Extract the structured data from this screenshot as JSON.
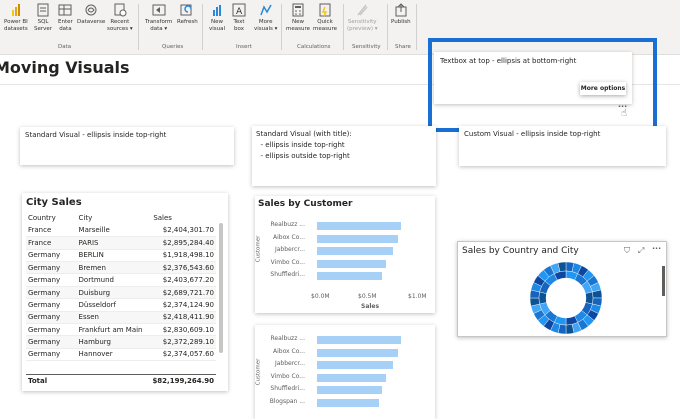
{
  "ribbon": {
    "buttons": [
      {
        "label": "Power BI\ndatasets",
        "icon": "power-bi-dataset-icon"
      },
      {
        "label": "SQL\nServer",
        "icon": "sql-server-icon"
      },
      {
        "label": "Enter\ndata",
        "icon": "table-icon"
      },
      {
        "label": "Dataverse",
        "icon": "dataverse-icon"
      },
      {
        "label": "Recent\nsources ▾",
        "icon": "recent-sources-icon"
      },
      {
        "label": "Transform\ndata ▾",
        "icon": "transform-data-icon"
      },
      {
        "label": "Refresh",
        "icon": "refresh-icon"
      },
      {
        "label": "New\nvisual",
        "icon": "new-visual-icon"
      },
      {
        "label": "Text\nbox",
        "icon": "text-box-icon"
      },
      {
        "label": "More\nvisuals ▾",
        "icon": "more-visuals-icon"
      },
      {
        "label": "New\nmeasure",
        "icon": "new-measure-icon"
      },
      {
        "label": "Quick\nmeasure",
        "icon": "quick-measure-icon"
      },
      {
        "label": "Sensitivity\n(preview) ▾",
        "icon": "sensitivity-icon"
      },
      {
        "label": "Publish",
        "icon": "publish-icon"
      }
    ],
    "groups": [
      "Data",
      "Queries",
      "Insert",
      "Calculations",
      "Sensitivity",
      "Share"
    ]
  },
  "page": {
    "title": "Moving Visuals"
  },
  "cards": {
    "textbox_top": "Textbox at top - ellipsis at bottom-right",
    "more_options": "More options",
    "standard_inside": "Standard Visual - ellipsis inside top-right",
    "standard_title_1": "Standard Visual (with title):",
    "standard_title_2": "  - ellipsis inside top-right",
    "standard_title_3": "  - ellipsis outside top-right",
    "custom_visual": "Custom Visual - ellipsis inside top-right"
  },
  "city_sales": {
    "title": "City Sales",
    "headers": [
      "Country",
      "City",
      "Sales"
    ],
    "rows": [
      [
        "France",
        "Marseille",
        "$2,404,301.70"
      ],
      [
        "France",
        "PARIS",
        "$2,895,284.40"
      ],
      [
        "Germany",
        "BERLIN",
        "$1,918,498.10"
      ],
      [
        "Germany",
        "Bremen",
        "$2,376,543.60"
      ],
      [
        "Germany",
        "Dortmund",
        "$2,403,677.20"
      ],
      [
        "Germany",
        "Duisburg",
        "$2,689,721.70"
      ],
      [
        "Germany",
        "Düsseldorf",
        "$2,374,124.90"
      ],
      [
        "Germany",
        "Essen",
        "$2,418,411.90"
      ],
      [
        "Germany",
        "Frankfurt am Main",
        "$2,830,609.10"
      ],
      [
        "Germany",
        "Hamburg",
        "$2,372,289.10"
      ],
      [
        "Germany",
        "Hannover",
        "$2,374,057.60"
      ]
    ],
    "total_label": "Total",
    "total_value": "$82,199,264.90"
  },
  "sales_by_customer": {
    "title": "Sales by Customer",
    "axis_y_label": "Customer",
    "axis_x_label": "Sales",
    "ticks": [
      "$0.0M",
      "$0.5M",
      "$1.0M"
    ],
    "customers": [
      "Realbuzz ...",
      "Aibox Co...",
      "Jabbercr...",
      "Vimbo Co...",
      "Shuffledri..."
    ],
    "values": [
      0.75,
      0.72,
      0.68,
      0.62,
      0.58
    ]
  },
  "sales_by_customer_2": {
    "axis_y_label": "Customer",
    "customers": [
      "Realbuzz ...",
      "Aibox Co...",
      "Jabbercr...",
      "Vimbo Co...",
      "Shuffledri...",
      "Blogspan ..."
    ],
    "values": [
      0.75,
      0.72,
      0.68,
      0.62,
      0.58,
      0.55
    ]
  },
  "donut": {
    "title": "Sales by Country and City",
    "colors": [
      "#1565c0",
      "#1e88e5",
      "#0d47a1",
      "#2196f3",
      "#1976d2",
      "#42a5f5",
      "#0b5394"
    ]
  },
  "colors": {
    "accent": "#1a6fd4",
    "bar": "#a6d0f5"
  }
}
